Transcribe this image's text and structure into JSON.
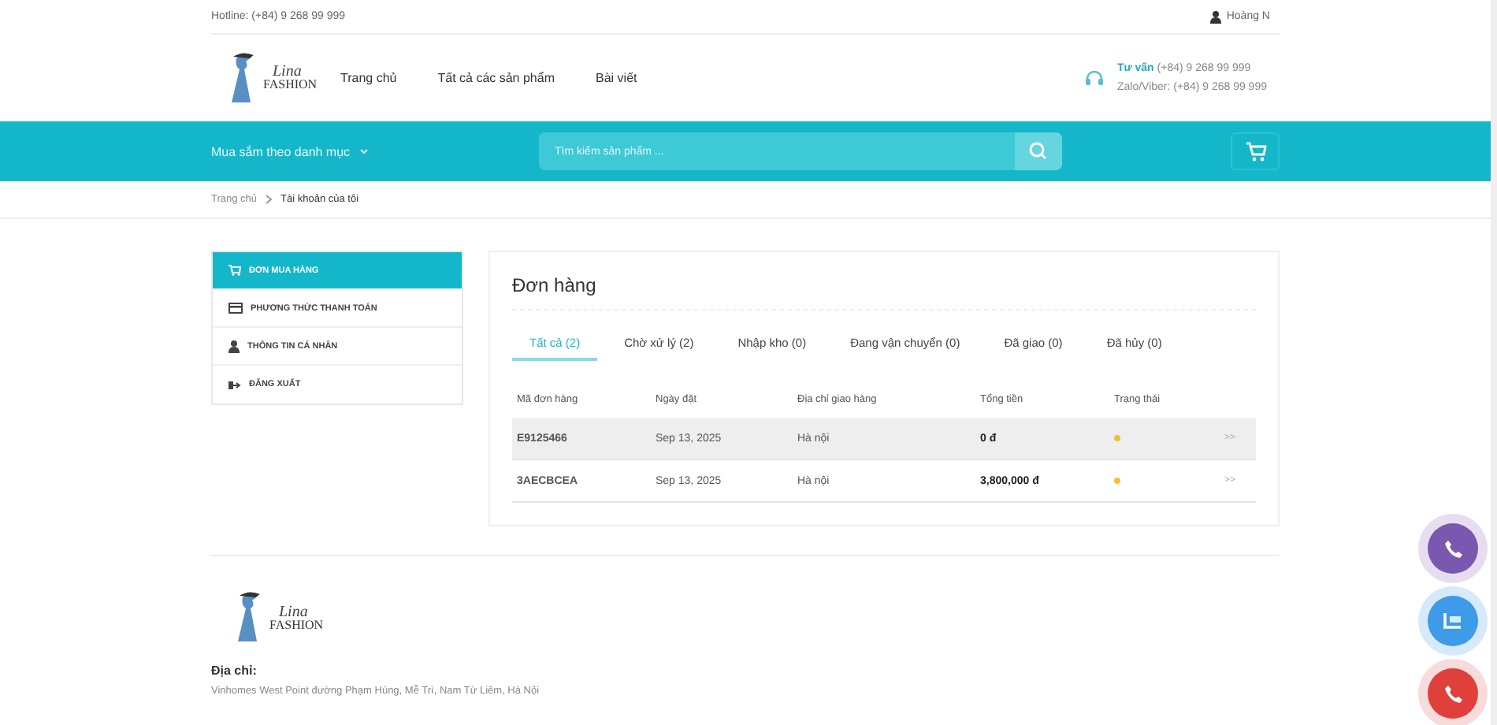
{
  "topbar": {
    "hotline": "Hotline: (+84) 9 268 99 999",
    "user": "Hoàng N"
  },
  "header": {
    "logo": {
      "script": "Lina",
      "word": "FASHION"
    },
    "nav": [
      {
        "label": "Trang chủ"
      },
      {
        "label": "Tất cả các sản phẩm"
      },
      {
        "label": "Bài viết"
      }
    ],
    "contact": {
      "label": "Tư vấn",
      "phone": "(+84) 9 268 99 999",
      "zalo": "Zalo/Viber: (+84) 9 268 99 999"
    }
  },
  "band": {
    "category": "Mua sắm theo danh mục",
    "search": {
      "placeholder": "Tìm kiếm sản phẩm ..."
    }
  },
  "breadcrumb": [
    {
      "label": "Trang chủ"
    },
    {
      "label": "Tài khoản của tôi"
    }
  ],
  "sidebar": {
    "items": [
      {
        "label": "ĐƠN MUA HÀNG",
        "selected": true
      },
      {
        "label": "PHƯƠNG THỨC THANH TOÁN",
        "selected": false
      },
      {
        "label": "THÔNG TIN CÁ NHÂN",
        "selected": false
      },
      {
        "label": "ĐĂNG XUẤT",
        "selected": false
      }
    ]
  },
  "orders": {
    "title": "Đơn hàng",
    "tabs": [
      {
        "label": "Tất cả (2)",
        "selected": true
      },
      {
        "label": "Chờ xử lý (2)",
        "selected": false
      },
      {
        "label": "Nhập kho (0)",
        "selected": false
      },
      {
        "label": "Đang vận chuyển (0)",
        "selected": false
      },
      {
        "label": "Đã giao (0)",
        "selected": false
      },
      {
        "label": "Đã hủy (0)",
        "selected": false
      }
    ],
    "columns": [
      "Mã đơn hàng",
      "Ngày đặt",
      "Địa chỉ giao hàng",
      "Tổng tiền",
      "Trạng thái"
    ],
    "rows": [
      {
        "code": "E9125466",
        "date": "Sep 13, 2025",
        "address": "Hà nội",
        "total": "0 đ",
        "color": "#f2c230",
        "link": ">>",
        "selected": true
      },
      {
        "code": "3AECBCEA",
        "date": "Sep 13, 2025",
        "address": "Hà nội",
        "total": "3,800,000 đ",
        "color": "#f2c230",
        "link": ">>",
        "selected": false
      }
    ]
  },
  "footer": {
    "logo": {
      "script": "Lina",
      "word": "FASHION"
    },
    "address_label": "Địa chỉ:",
    "address": "Vinhomes West Point đường Phạm Hùng, Mễ Trì, Nam Từ Liêm, Hà Nội"
  },
  "floating": [
    {
      "kind": "viber"
    },
    {
      "kind": "zalo"
    },
    {
      "kind": "phone"
    }
  ]
}
